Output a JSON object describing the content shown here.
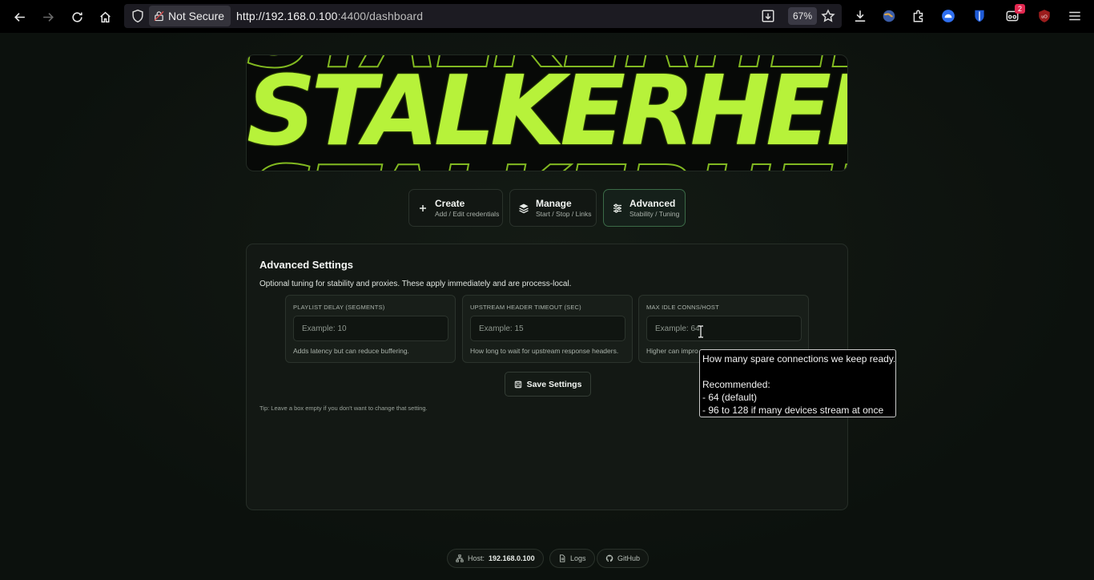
{
  "browser": {
    "security_label": "Not Secure",
    "url_host": "http://192.168.0.100",
    "url_rest": ":4400/dashboard",
    "zoom": "67%",
    "extension_badge": "2"
  },
  "logo": {
    "text": "STALKERHEK"
  },
  "tabs": [
    {
      "title": "Create",
      "subtitle": "Add / Edit credentials",
      "icon": "plus-icon"
    },
    {
      "title": "Manage",
      "subtitle": "Start / Stop / Links",
      "icon": "layers-icon"
    },
    {
      "title": "Advanced",
      "subtitle": "Stability / Tuning",
      "icon": "sliders-icon"
    }
  ],
  "panel": {
    "title": "Advanced Settings",
    "description": "Optional tuning for stability and proxies. These apply immediately and are process-local.",
    "fields": [
      {
        "label": "Playlist Delay (Segments)",
        "placeholder": "Example: 10",
        "hint": "Adds latency but can reduce buffering."
      },
      {
        "label": "Upstream Header Timeout (sec)",
        "placeholder": "Example: 15",
        "hint": "How long to wait for upstream response headers."
      },
      {
        "label": "Max Idle Conns/Host",
        "placeholder": "Example: 64",
        "hint": "Higher can impro"
      }
    ],
    "save_label": "Save Settings",
    "tip": "Tip: Leave a box empty if you don't want to change that setting."
  },
  "tooltip": {
    "text": "How many spare connections we keep ready.\n\nRecommended:\n- 64 (default)\n- 96 to 128 if many devices stream at once"
  },
  "footer": {
    "host_label": "Host:",
    "host_value": "192.168.0.100",
    "logs_label": "Logs",
    "github_label": "GitHub"
  },
  "colors": {
    "accent": "#b7f23a",
    "background": "#0d120e",
    "active_border": "#3b6a47"
  }
}
